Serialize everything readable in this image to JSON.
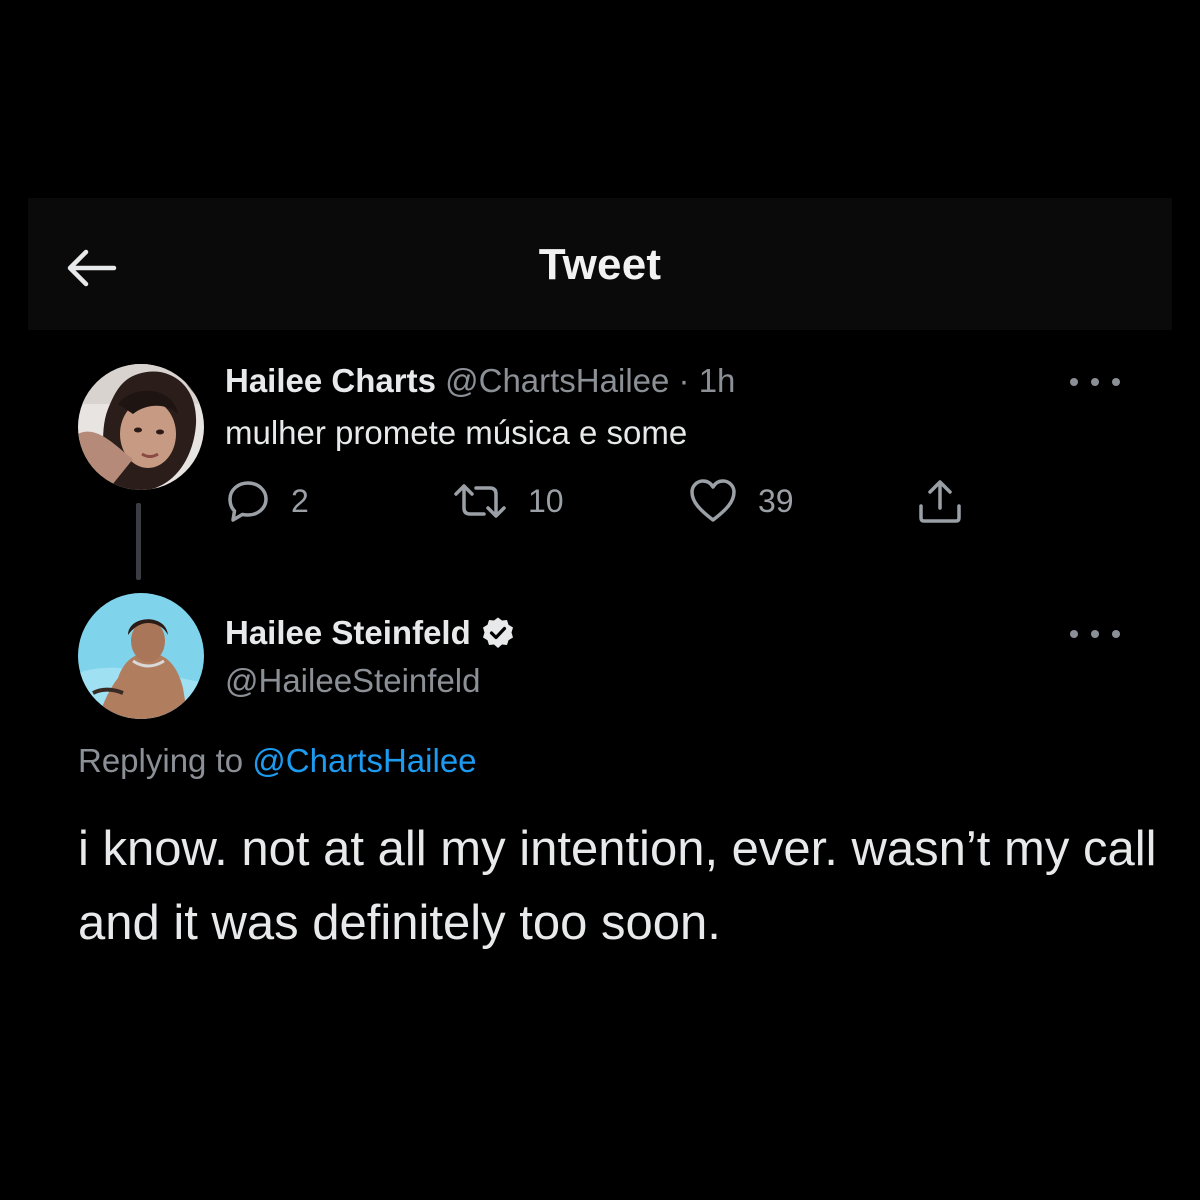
{
  "header": {
    "back_icon": "arrow-left-icon",
    "title": "Tweet"
  },
  "parent_tweet": {
    "author_name": "Hailee Charts",
    "handle": "@ChartsHailee",
    "separator": "·",
    "time": "1h",
    "text": "mulher promete música e some",
    "more_icon": "more-horizontal-icon",
    "actions": {
      "reply_icon": "reply-icon",
      "reply_count": "2",
      "retweet_icon": "retweet-icon",
      "retweet_count": "10",
      "like_icon": "heart-icon",
      "like_count": "39",
      "share_icon": "share-icon"
    }
  },
  "main_tweet": {
    "author_name": "Hailee Steinfeld",
    "verified_icon": "verified-badge-icon",
    "handle": "@HaileeSteinfeld",
    "more_icon": "more-horizontal-icon",
    "replying_prefix": "Replying to",
    "replying_to": "@ChartsHailee",
    "text": "i know. not at all my intention, ever. wasn’t my call and it was definitely too soon."
  },
  "colors": {
    "background": "#000000",
    "header_background": "#0a0a0a",
    "primary_text": "#e7e9ea",
    "secondary_text": "#8b9096",
    "link": "#1d9bf0"
  }
}
